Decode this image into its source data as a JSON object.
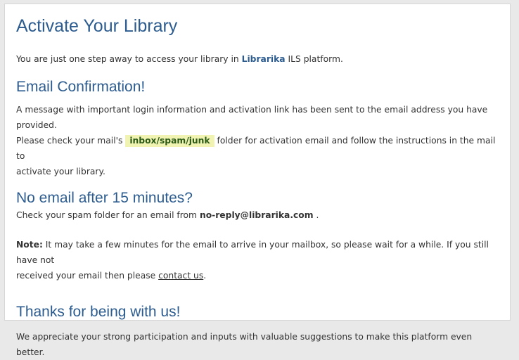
{
  "page": {
    "title": "Activate Your Library",
    "intro": {
      "before": "You are just one step away to access your library in ",
      "brand": "Librarika",
      "after": " ILS platform."
    },
    "email_confirmation": {
      "heading": "Email Confirmation!",
      "line1": "A message with important login information and activation link has been sent to the email address you have provided.",
      "line2_before": "Please check your mail's ",
      "highlight": "inbox/spam/junk",
      "line2_after": " folder for activation email and follow the instructions in the mail to",
      "line3": "activate your library."
    },
    "no_email": {
      "heading": "No email after 15 minutes?",
      "text_before": "Check your spam folder for an email from ",
      "email": "no-reply@librarika.com",
      "text_after": " ."
    },
    "note": {
      "label": "Note:",
      "text_line1": " It may take a few minutes for the email to arrive in your mailbox, so please wait for a while. If you still have not",
      "text_line2_before": "received your email then please ",
      "link": "contact us",
      "text_line2_after": "."
    },
    "thanks": {
      "heading": "Thanks for being with us!",
      "text": "We appreciate your strong participation and inputs with valuable suggestions to make this platform even better."
    }
  },
  "colors": {
    "heading": "#2c5c8f",
    "highlight_bg": "#f1f3b3",
    "highlight_text": "#2b5a17",
    "body_text": "#333333"
  }
}
